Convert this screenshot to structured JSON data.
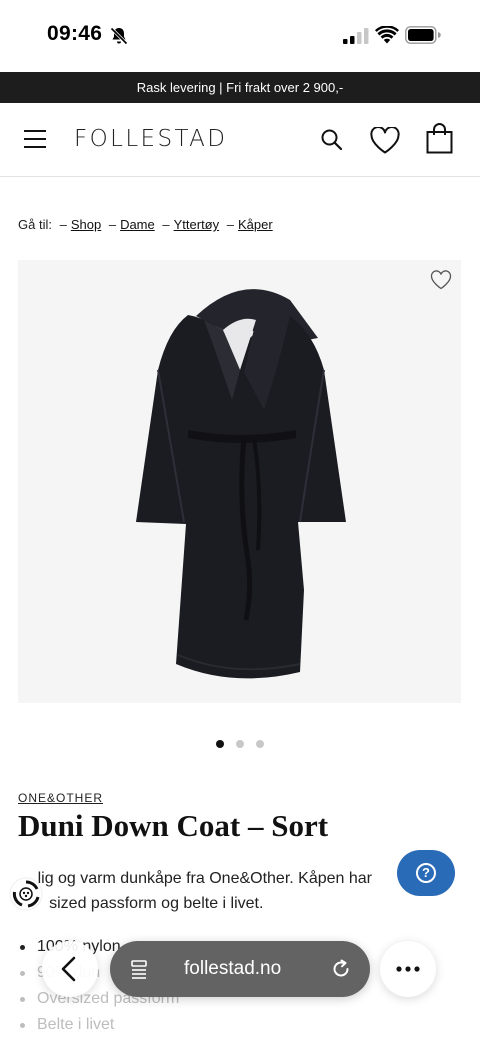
{
  "status_bar": {
    "time": "09:46",
    "icons": [
      "bell-slash-icon",
      "signal-icon",
      "wifi-icon",
      "battery-icon"
    ]
  },
  "promo_banner": {
    "text": "Rask levering | Fri frakt over 2 900,-"
  },
  "header": {
    "logo": "FOLLESTAD",
    "icons": [
      "menu-icon",
      "search-icon",
      "heart-icon",
      "shopping-bag-icon"
    ]
  },
  "breadcrumb": {
    "prefix": "Gå til:",
    "separator": "–",
    "items": [
      "Shop",
      "Dame",
      "Yttertøy",
      "Kåper"
    ]
  },
  "product": {
    "brand": "ONE&OTHER",
    "title": "Duni Down Coat – Sort",
    "description_line1": "lig og varm dunkåpe fra One&Other. Kåpen har",
    "description_line2": "sized passform og belte i livet.",
    "features": [
      "100% nylon",
      "90% dun",
      "Oversized passform",
      "Belte i livet"
    ],
    "image_count": 3,
    "active_image": 1
  },
  "colors": {
    "banner_bg": "#1d1d1d",
    "help_button": "#2a6bb8",
    "url_pill": "#636363",
    "coat": "#1b1b22"
  },
  "browser": {
    "url": "follestad.no"
  },
  "help": {
    "icon": "question-icon"
  }
}
